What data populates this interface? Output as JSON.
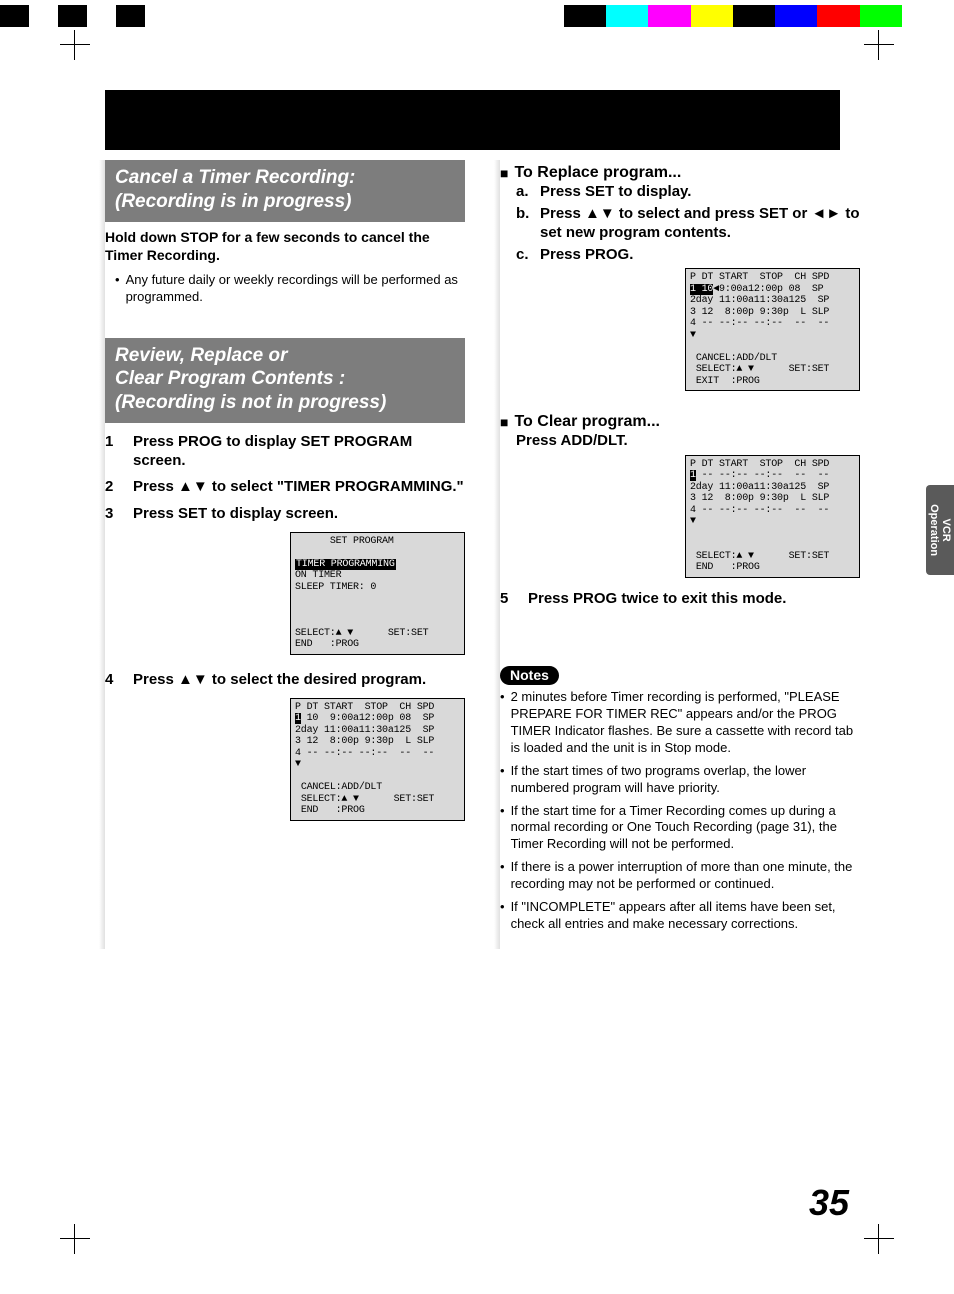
{
  "colorbar": true,
  "section1": {
    "title": "Cancel a Timer Recording:\n(Recording is in progress)",
    "lead": "Hold down STOP for a few seconds to cancel the Timer Recording.",
    "note": "Any future daily or weekly recordings will be performed as programmed."
  },
  "section2": {
    "title": "Review, Replace or\nClear Program Contents :\n(Recording is not in progress)",
    "steps": [
      "Press PROG to display SET PROGRAM screen.",
      "Press ▲▼ to select \"TIMER PROGRAMMING.\"",
      "Press SET to display screen."
    ],
    "osd1_title": "SET PROGRAM",
    "osd1_hl": "TIMER PROGRAMMING",
    "osd1_l2": "ON TIMER",
    "osd1_l3": "SLEEP TIMER: 0",
    "osd1_foot1": "SELECT:▲ ▼      SET:SET",
    "osd1_foot2": "END   :PROG",
    "step4": "Press ▲▼ to select the desired program.",
    "osd2_head": "P DT START  STOP  CH SPD",
    "osd2_r1a": "1",
    "osd2_r1b": " 10  9:00a12:00p 08  SP",
    "osd2_r2": "2day 11:00a11:30a125  SP",
    "osd2_r3": "3 12  8:00p 9:30p  L SLP",
    "osd2_r4": "4 -- --:-- --:--  --  --",
    "osd2_arrow": "▼",
    "osd2_f1": "CANCEL:ADD/DLT",
    "osd2_f2": "SELECT:▲ ▼      SET:SET",
    "osd2_f3": "END   :PROG"
  },
  "right": {
    "replace_head": "To Replace program...",
    "replace_a": "Press SET to display.",
    "replace_b": "Press ▲▼ to select and press SET or ◄► to set new program contents.",
    "replace_c": "Press PROG.",
    "osdA_head": "P DT START  STOP  CH SPD",
    "osdA_r1a": "1",
    "osdA_r1b": " 10",
    "osdA_r1c": "9:00a12:00p 08  SP",
    "osdA_r2": "2day 11:00a11:30a125  SP",
    "osdA_r3": "3 12  8:00p 9:30p  L SLP",
    "osdA_r4": "4 -- --:-- --:--  --  --",
    "osdA_arrow": "▼",
    "osdA_f1": "CANCEL:ADD/DLT",
    "osdA_f2": "SELECT:▲ ▼      SET:SET",
    "osdA_f3": "EXIT  :PROG",
    "clear_head": "To Clear program...",
    "clear_line": "Press ADD/DLT.",
    "osdB_head": "P DT START  STOP  CH SPD",
    "osdB_r1a": "1",
    "osdB_r1b": " -- --:-- --:--  --  --",
    "osdB_r2": "2day 11:00a11:30a125  SP",
    "osdB_r3": "3 12  8:00p 9:30p  L SLP",
    "osdB_r4": "4 -- --:-- --:--  --  --",
    "osdB_arrow": "▼",
    "osdB_f2": "SELECT:▲ ▼      SET:SET",
    "osdB_f3": "END   :PROG",
    "step5": "Press PROG twice to exit this mode."
  },
  "notes_label": "Notes",
  "notes": [
    "2 minutes before Timer recording is performed, \"PLEASE PREPARE FOR TIMER REC\" appears and/or the PROG TIMER Indicator flashes. Be sure a cassette with record tab is loaded and the unit is in Stop mode.",
    "If the start times of two programs overlap, the lower numbered program will have priority.",
    "If the start time for a Timer Recording comes up during a normal recording or One Touch Recording (page 31), the Timer Recording will not be performed.",
    "If there is a power interruption of more than one minute, the recording may not be performed or continued.",
    "If \"INCOMPLETE\" appears after all items have been set, check all entries and make necessary corrections."
  ],
  "sidetab": "VCR\nOperation",
  "pagenum": "35"
}
